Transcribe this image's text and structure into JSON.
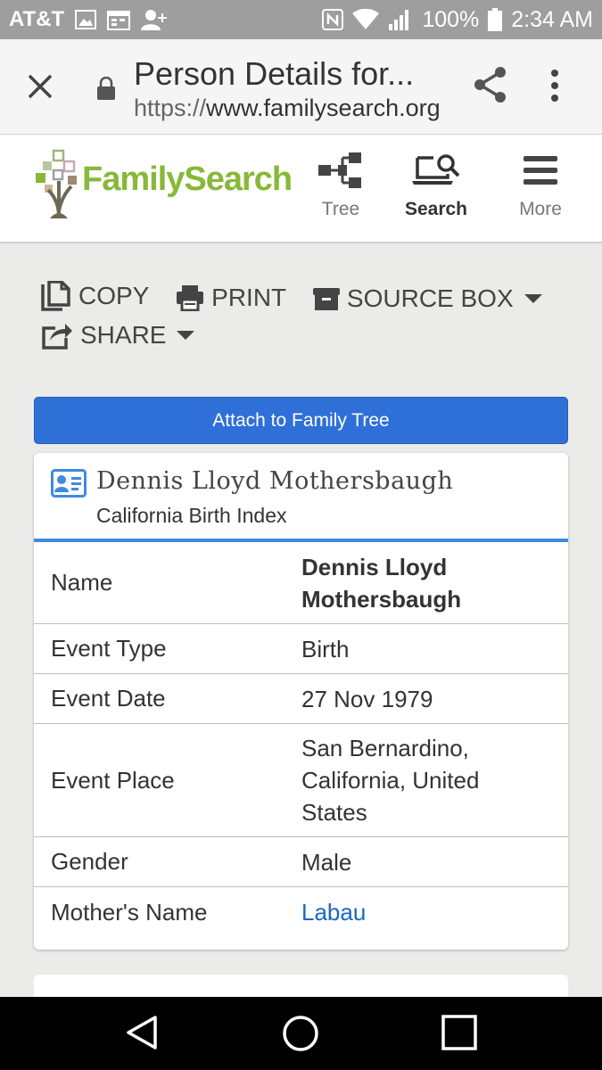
{
  "status_bar": {
    "carrier": "AT&T",
    "battery": "100%",
    "time": "2:34 AM"
  },
  "browser": {
    "title": "Person Details for...",
    "url_protocol": "https://",
    "url_host": "www.familysearch.org"
  },
  "site_header": {
    "logo_text": "FamilySearch",
    "nav": [
      {
        "label": "Tree",
        "icon": "tree-icon"
      },
      {
        "label": "Search",
        "icon": "search-laptop-icon"
      },
      {
        "label": "More",
        "icon": "hamburger-menu-icon"
      }
    ]
  },
  "actions": {
    "copy": "COPY",
    "print": "PRINT",
    "source_box": "SOURCE BOX",
    "share": "SHARE"
  },
  "attach_button": "Attach to Family Tree",
  "record": {
    "name": "Dennis Lloyd Mothersbaugh",
    "collection": "California Birth Index",
    "fields": [
      {
        "label": "Name",
        "value": "Dennis Lloyd Mothersbaugh"
      },
      {
        "label": "Event Type",
        "value": "Birth"
      },
      {
        "label": "Event Date",
        "value": "27 Nov 1979"
      },
      {
        "label": "Event Place",
        "value": "San Bernardino, California, United States"
      },
      {
        "label": "Gender",
        "value": "Male"
      },
      {
        "label": "Mother's Name",
        "value": "Labau"
      }
    ]
  },
  "colors": {
    "accent_blue": "#2f6fd8",
    "link_blue": "#1a67c4",
    "logo_green": "#87b838"
  }
}
